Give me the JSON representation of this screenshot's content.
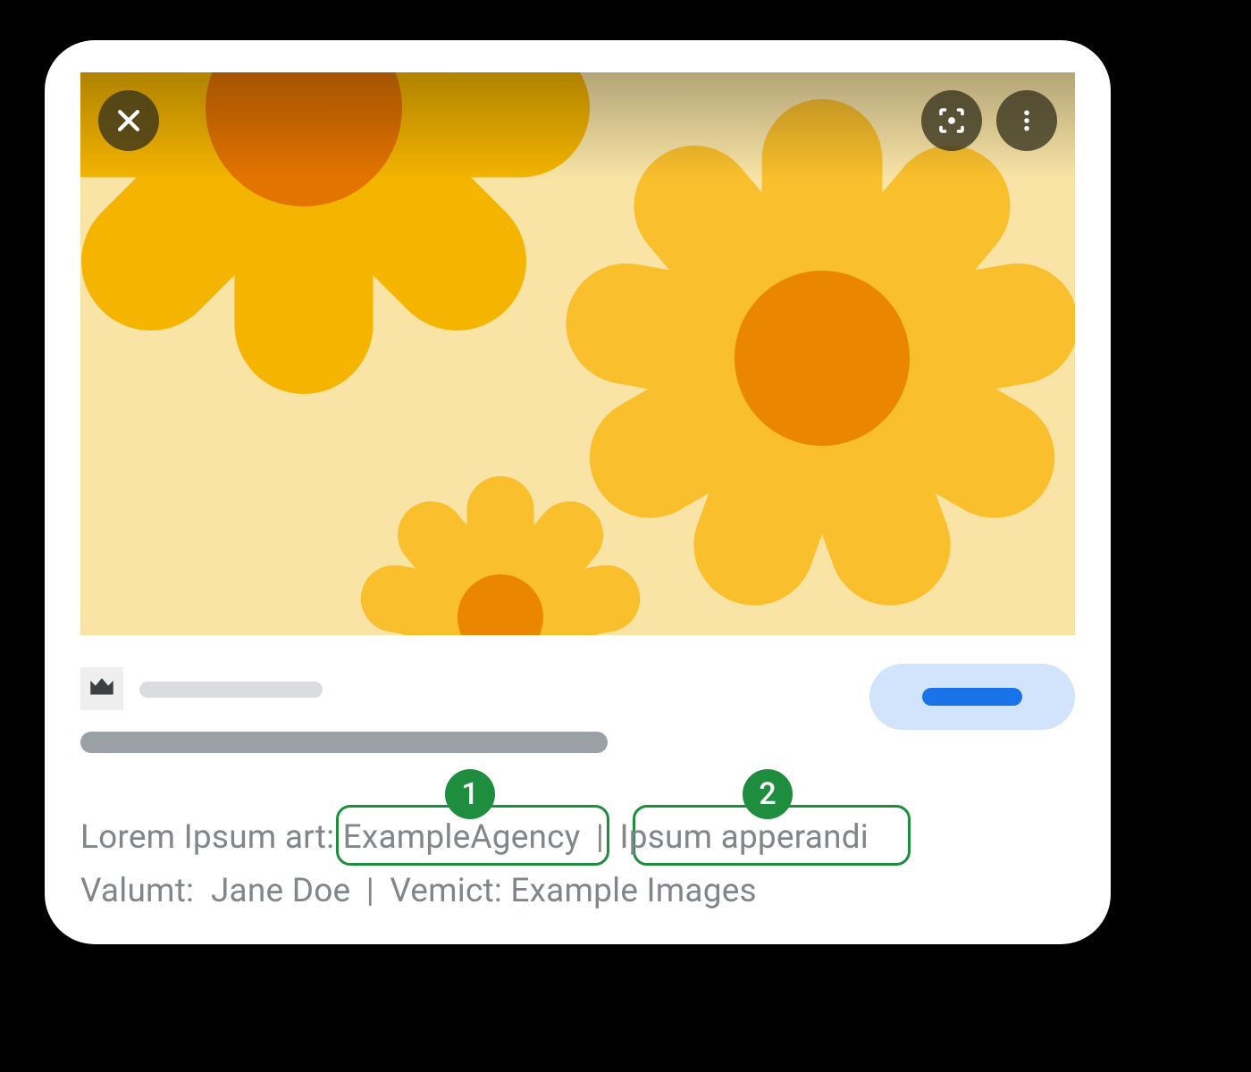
{
  "callouts": {
    "one": "1",
    "two": "2"
  },
  "meta": {
    "line1_label": "Lorem Ipsum art:",
    "line1_value1": "ExampleAgency",
    "line1_sep": "|",
    "line1_value2": "Ipsum apperandi",
    "line2_label1": "Valumt:",
    "line2_value1": "Jane Doe",
    "line2_sep": "|",
    "line2_label2": "Vemict:",
    "line2_value2": "Example Images"
  },
  "icons": {
    "close": "close-icon",
    "lens": "lens-icon",
    "more": "more-vert-icon",
    "crown": "crown-icon"
  },
  "colors": {
    "petal_main": "#f9bf2c",
    "petal_left": "#f4b400",
    "flower_center_big": "#e37400",
    "flower_center_small": "#ea8600",
    "hero_bg": "#f9e4a6",
    "callout_green": "#1e8e3e",
    "pill_bg": "#d2e3fc",
    "pill_fg": "#1a73e8",
    "text_muted": "#80868b"
  }
}
